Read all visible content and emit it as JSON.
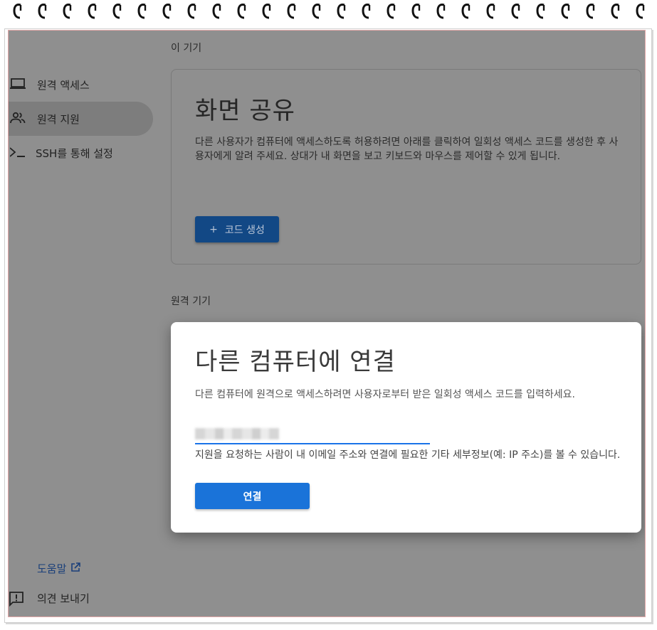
{
  "sidebar": {
    "items": [
      {
        "label": "원격 액세스",
        "icon": "laptop-icon",
        "active": false
      },
      {
        "label": "원격 지원",
        "icon": "people-icon",
        "active": true
      },
      {
        "label": "SSH를 통해 설정",
        "icon": "terminal-icon",
        "active": false
      }
    ],
    "help_label": "도움말",
    "feedback_label": "의견 보내기"
  },
  "this_device": {
    "section_label": "이 기기",
    "title": "화면 공유",
    "description": "다른 사용자가 컴퓨터에 액세스하도록 허용하려면 아래를 클릭하여 일회성 액세스 코드를 생성한 후 사용자에게 알려 주세요. 상대가 내 화면을 보고 키보드와 마우스를 제어할 수 있게 됩니다.",
    "generate_button": "코드 생성",
    "generate_icon": "plus-icon"
  },
  "remote_device": {
    "section_label": "원격 기기"
  },
  "connect_dialog": {
    "title": "다른 컴퓨터에 연결",
    "description": "다른 컴퓨터에 원격으로 액세스하려면 사용자로부터 받은 일회성 액세스 코드를 입력하세요.",
    "code_value": "",
    "note": "지원을 요청하는 사람이 내 이메일 주소와 연결에 필요한 기타 세부정보(예: IP 주소)를 볼 수 있습니다.",
    "connect_button": "연결"
  },
  "colors": {
    "accent": "#1a73d9",
    "overlay": "#8f8f8f",
    "generate_button": "#124885",
    "link": "#1a3f7a"
  }
}
